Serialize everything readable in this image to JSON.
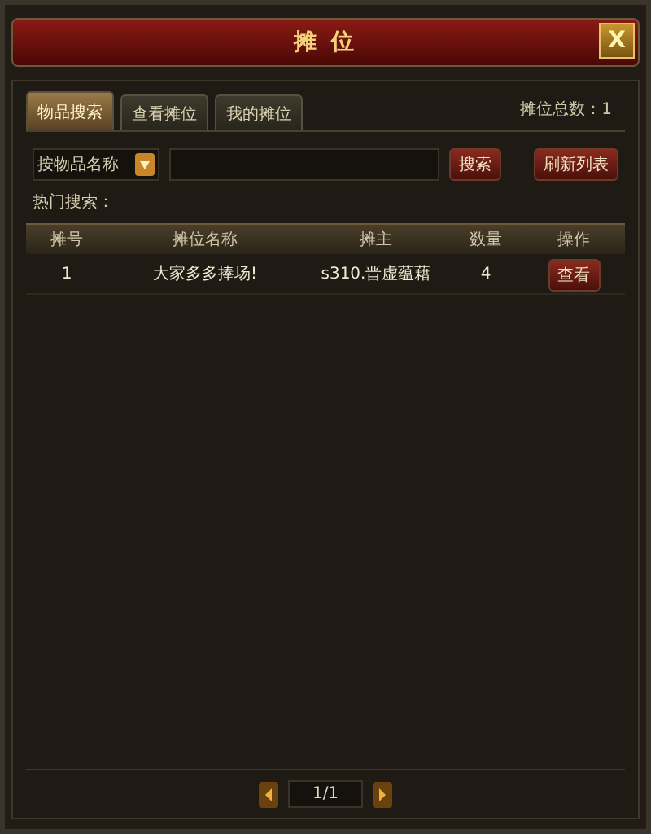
{
  "window": {
    "title": "摊 位",
    "close": "X"
  },
  "tabs": [
    {
      "label": "物品搜索",
      "selected": true
    },
    {
      "label": "查看摊位",
      "selected": false
    },
    {
      "label": "我的摊位",
      "selected": false
    }
  ],
  "stall_total": "摊位总数：1",
  "search": {
    "filter": "按物品名称",
    "search_button": "搜索",
    "refresh_button": "刷新列表"
  },
  "hot_search": "热门搜索：",
  "table": {
    "columns": [
      "摊号",
      "摊位名称",
      "摊主",
      "数量",
      "操作"
    ],
    "rows": [
      {
        "cells": [
          "1",
          "大家多多捧场!",
          "s310.晋虚蕴藉",
          "4"
        ],
        "action": "查看"
      }
    ]
  },
  "pagination": {
    "page": "1/1"
  }
}
